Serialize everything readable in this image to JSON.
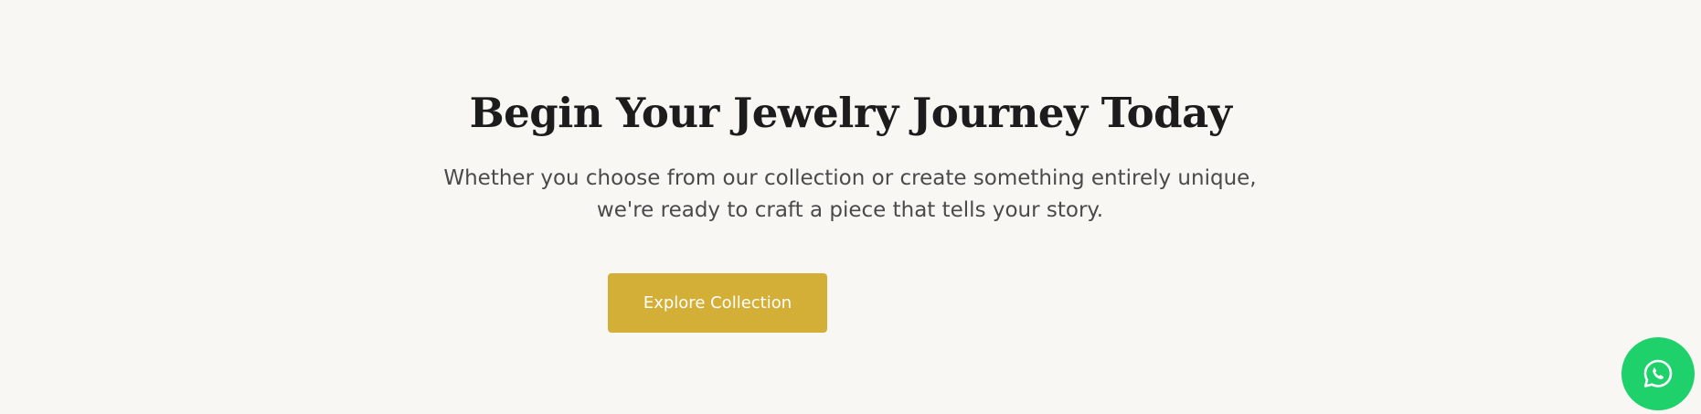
{
  "cta": {
    "title": "Begin Your Jewelry Journey Today",
    "subtitle": "Whether you choose from our collection or create something entirely unique, we're ready to craft a piece that tells your story.",
    "button_label": "Explore Collection"
  },
  "floating": {
    "whatsapp_icon": "whatsapp-icon"
  },
  "colors": {
    "background": "#f9f7f4",
    "accent": "#d4af37",
    "whatsapp": "#1fd16b",
    "heading": "#1c1c1c",
    "body_text": "#4a4a4a"
  }
}
